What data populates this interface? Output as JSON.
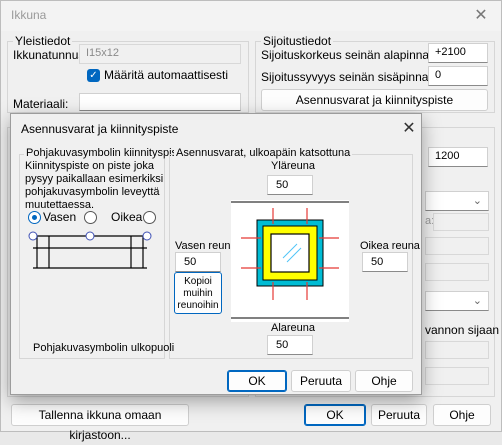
{
  "window": {
    "title": "Ikkuna",
    "close_icon": "close-icon"
  },
  "general": {
    "legend": "Yleistiedot",
    "id_label": "Ikkunatunnus:",
    "id_value": "I15x12",
    "auto_label": "Määritä automaattisesti",
    "material_label": "Materiaali:"
  },
  "placement": {
    "legend": "Sijoitustiedot",
    "sill_label": "Sijoituskorkeus seinän alapinnasta:",
    "sill_value": "+2100",
    "depth_label": "Sijoitussyvyys seinän sisäpinnasta:",
    "depth_value": "0",
    "clearance_button": "Asennusvarat ja kiinnityspiste"
  },
  "behind": {
    "value_1200": "1200",
    "partial_a": "a:",
    "partial_text": "vannon sijaan"
  },
  "bottom": {
    "save_button": "Tallenna ikkuna omaan kirjastoon...",
    "ok": "OK",
    "cancel": "Peruuta",
    "help": "Ohje"
  },
  "dialog": {
    "title": "Asennusvarat ja kiinnityspiste",
    "left_group": {
      "legend": "Pohjakuvasymbolin kiinnityspiste",
      "description": "Kiinnityspiste on piste joka pysyy paikallaan esimerkiksi pohjakuvasymbolin leveyttä muutettaessa.",
      "radio_left": "Vasen",
      "radio_right": "Oikea",
      "outside_label": "Pohjakuvasymbolin ulkopuoli"
    },
    "right_group": {
      "legend": "Asennusvarat, ulkoapäin katsottuna",
      "top_label": "Yläreuna",
      "top_value": "50",
      "left_label": "Vasen reuna",
      "left_value": "50",
      "right_label": "Oikea reuna",
      "right_value": "50",
      "bottom_label": "Alareuna",
      "bottom_value": "50",
      "copy_button": "Kopioi muihin reunoihin"
    },
    "ok": "OK",
    "cancel": "Peruuta",
    "help": "Ohje",
    "colors": {
      "frame_outer": "#00bcd4",
      "frame_inner": "#ffff00",
      "glass": "#ffffff",
      "arrows": "#e53935"
    }
  }
}
